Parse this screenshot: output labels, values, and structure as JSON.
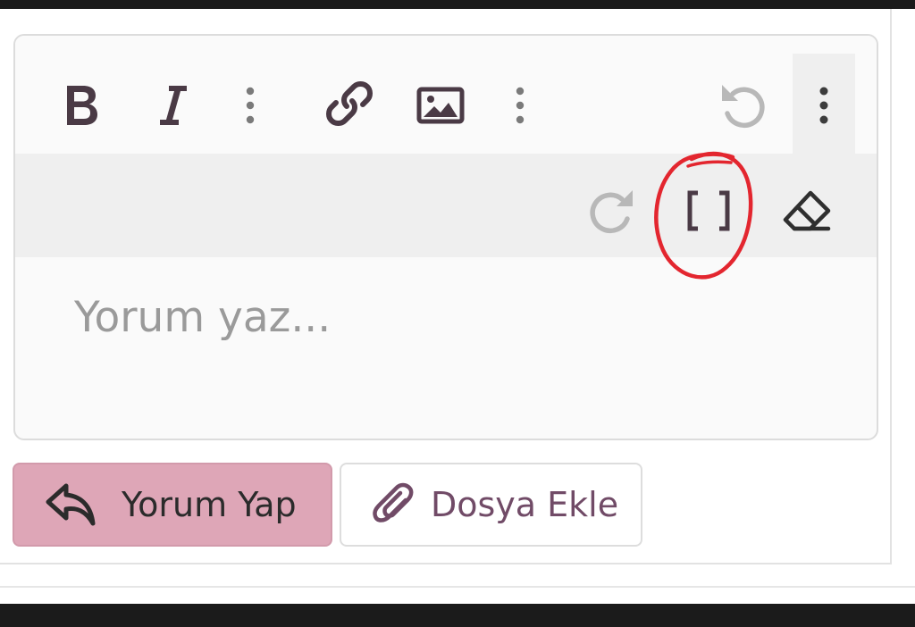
{
  "editor": {
    "placeholder": "Yorum yaz...",
    "toolbar": {
      "row1": [
        {
          "name": "bold-button",
          "icon": "bold-icon"
        },
        {
          "name": "italic-button",
          "icon": "italic-icon"
        },
        {
          "name": "more-format-button",
          "icon": "vertical-dots-icon"
        },
        {
          "name": "link-button",
          "icon": "link-icon"
        },
        {
          "name": "image-button",
          "icon": "image-icon"
        },
        {
          "name": "more-insert-button",
          "icon": "vertical-dots-icon"
        },
        {
          "name": "undo-button",
          "icon": "undo-icon"
        },
        {
          "name": "more-options-button",
          "icon": "vertical-dots-icon"
        }
      ],
      "row2": [
        {
          "name": "redo-button",
          "icon": "redo-icon"
        },
        {
          "name": "code-view-button",
          "icon": "code-brackets-icon"
        },
        {
          "name": "clear-format-button",
          "icon": "eraser-icon"
        }
      ]
    }
  },
  "actions": {
    "comment_label": "Yorum Yap",
    "attach_label": "Dosya Ekle"
  },
  "colors": {
    "primary_button_bg": "#dea6b7",
    "brand": "#714b67",
    "annotation": "#e3262f"
  }
}
